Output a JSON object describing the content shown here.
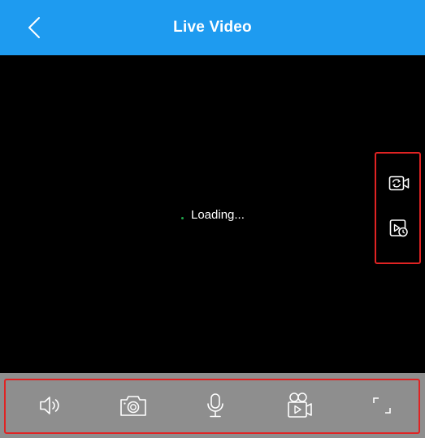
{
  "header": {
    "title": "Live Video",
    "back_icon": "chevron-left-icon",
    "background_color": "#1e9bf0"
  },
  "video": {
    "status_text": "Loading...",
    "background_color": "#000000",
    "spinner_color": "#1fa34a"
  },
  "side_controls": [
    {
      "name": "switch-camera-icon"
    },
    {
      "name": "playback-icon"
    }
  ],
  "toolbar": {
    "background_color": "#8e8e8e",
    "items": [
      {
        "name": "speaker-icon"
      },
      {
        "name": "snapshot-camera-icon"
      },
      {
        "name": "microphone-icon"
      },
      {
        "name": "record-video-icon"
      },
      {
        "name": "fullscreen-icon"
      }
    ]
  },
  "highlight_color": "#e02323"
}
